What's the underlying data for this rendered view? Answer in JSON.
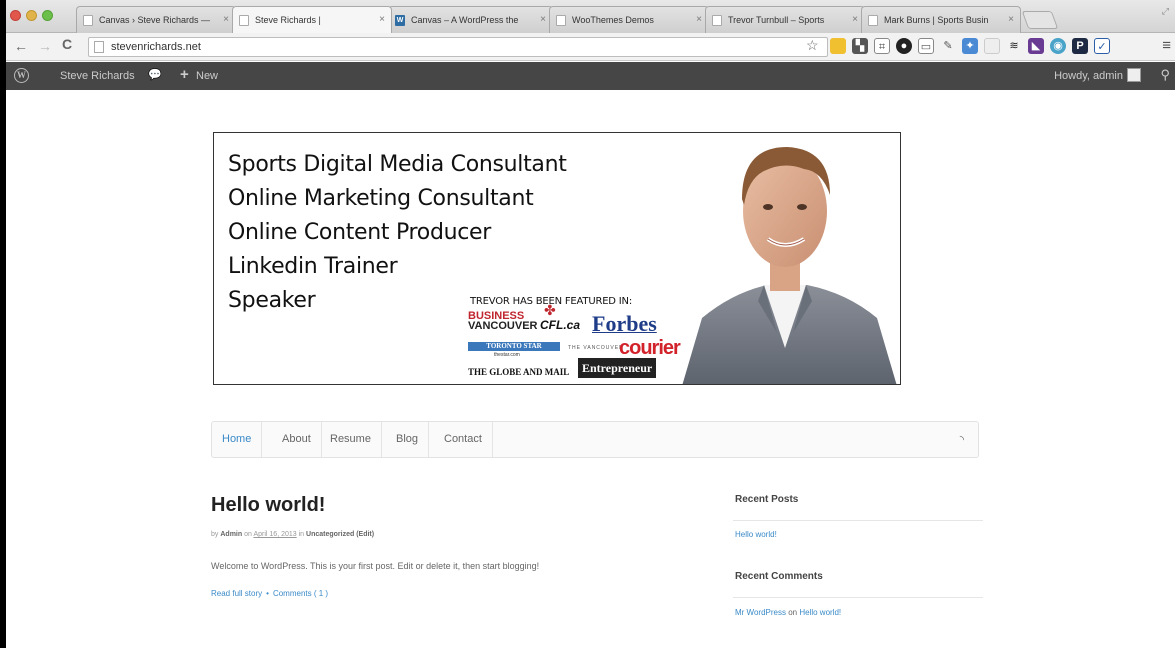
{
  "browser": {
    "tabs": [
      {
        "title": "Canvas › Steve Richards —",
        "icon": "page",
        "active": false
      },
      {
        "title": "Steve Richards |",
        "icon": "page",
        "active": true
      },
      {
        "title": "Canvas – A WordPress the",
        "icon": "wp",
        "active": false
      },
      {
        "title": "WooThemes Demos",
        "icon": "page",
        "active": false
      },
      {
        "title": "Trevor Turnbull – Sports",
        "icon": "page",
        "active": false
      },
      {
        "title": "Mark Burns | Sports Busin",
        "icon": "page",
        "active": false
      }
    ],
    "url": "stevenrichards.net",
    "extensions": [
      "star-icon",
      "note-icon",
      "qr-icon",
      "crop-icon",
      "circle-icon",
      "screen-icon",
      "pen-icon",
      "puzzle-icon",
      "box-icon",
      "buffer-icon",
      "pocket-icon",
      "dot-icon",
      "p-icon",
      "check-icon",
      "menu-icon"
    ]
  },
  "adminbar": {
    "site_name": "Steve Richards",
    "new_label": "New",
    "howdy": "Howdy, admin"
  },
  "banner": {
    "roles": [
      "Sports Digital Media Consultant",
      "Online Marketing Consultant",
      "Online Content Producer",
      "Linkedin Trainer",
      "Speaker"
    ],
    "featured_label": "TREVOR HAS BEEN FEATURED IN:",
    "logos": {
      "bv_line1": "BUSINESS",
      "bv_line2": "VANCOUVER",
      "cfl": "CFL.ca",
      "forbes": "Forbes",
      "toronto_star": "TORONTO STAR",
      "toronto_star_sub": "thestar.com",
      "vc_small": "THE VANCOUVER",
      "courier": "courier",
      "globe": "THE GLOBE AND MAIL",
      "entrepreneur": "Entrepreneur"
    }
  },
  "nav": {
    "items": [
      "Home",
      "About",
      "Resume",
      "Blog",
      "Contact"
    ],
    "active": "Home"
  },
  "post": {
    "title": "Hello world!",
    "meta_by": "by",
    "meta_author": "Admin",
    "meta_on": "on",
    "meta_date": "April 16, 2013",
    "meta_in": "in",
    "meta_category": "Uncategorized",
    "meta_edit": "(Edit)",
    "body": "Welcome to WordPress. This is your first post. Edit or delete it, then start blogging!",
    "read_more": "Read full story",
    "comments": "Comments ( 1 )"
  },
  "sidebar": {
    "recent_posts_title": "Recent Posts",
    "recent_posts": [
      "Hello world!"
    ],
    "recent_comments_title": "Recent Comments",
    "comment_author": "Mr WordPress",
    "comment_on": "on",
    "comment_post": "Hello world!"
  }
}
